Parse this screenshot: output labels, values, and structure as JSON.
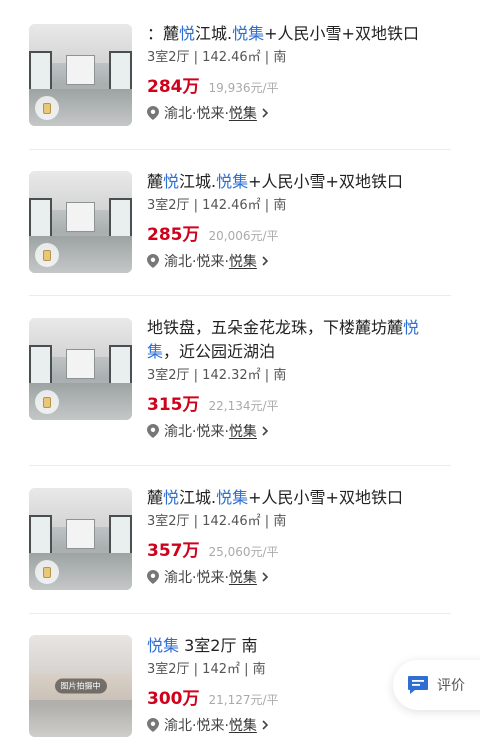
{
  "listings": [
    {
      "title_parts": [
        {
          "text": "：麓",
          "hl": false
        },
        {
          "text": "悦",
          "hl": true
        },
        {
          "text": "江城.",
          "hl": false
        },
        {
          "text": "悦集",
          "hl": true
        },
        {
          "text": "+人民小雪+双地铁口",
          "hl": false
        }
      ],
      "meta": "3室2厅 | 142.46㎡ | 南",
      "price": "284万",
      "unit_price": "19,936元/平",
      "district": "渝北·悦来·",
      "community": "悦集"
    },
    {
      "title_parts": [
        {
          "text": "麓",
          "hl": false
        },
        {
          "text": "悦",
          "hl": true
        },
        {
          "text": "江城.",
          "hl": false
        },
        {
          "text": "悦集",
          "hl": true
        },
        {
          "text": "+人民小雪+双地铁口",
          "hl": false
        }
      ],
      "meta": "3室2厅 | 142.46㎡ | 南",
      "price": "285万",
      "unit_price": "20,006元/平",
      "district": "渝北·悦来·",
      "community": "悦集"
    },
    {
      "title_parts": [
        {
          "text": "地铁盘，五朵金花龙珠，下楼麓坊麓",
          "hl": false
        },
        {
          "text": "悦",
          "hl": true
        },
        {
          "text": "集",
          "hl": true
        },
        {
          "text": "，近公园近湖泊",
          "hl": false
        }
      ],
      "meta": "3室2厅 | 142.32㎡ | 南",
      "price": "315万",
      "unit_price": "22,134元/平",
      "district": "渝北·悦来·",
      "community": "悦集"
    },
    {
      "title_parts": [
        {
          "text": "麓",
          "hl": false
        },
        {
          "text": "悦",
          "hl": true
        },
        {
          "text": "江城.",
          "hl": false
        },
        {
          "text": "悦集",
          "hl": true
        },
        {
          "text": "+人民小雪+双地铁口",
          "hl": false
        }
      ],
      "meta": "3室2厅 | 142.46㎡ | 南",
      "price": "357万",
      "unit_price": "25,060元/平",
      "district": "渝北·悦来·",
      "community": "悦集"
    },
    {
      "title_parts": [
        {
          "text": "悦集",
          "hl": true
        },
        {
          "text": " 3室2厅 南",
          "hl": false
        }
      ],
      "meta": "3室2厅 | 142㎡ | 南",
      "price": "300万",
      "unit_price": "21,127元/平",
      "district": "渝北·悦来·",
      "community": "悦集",
      "photo_tag": "图片拍摄中"
    }
  ],
  "fab": {
    "label": "评价",
    "icon": "comment-icon"
  },
  "colors": {
    "highlight": "#2f6fd1",
    "price": "#d0021b"
  }
}
